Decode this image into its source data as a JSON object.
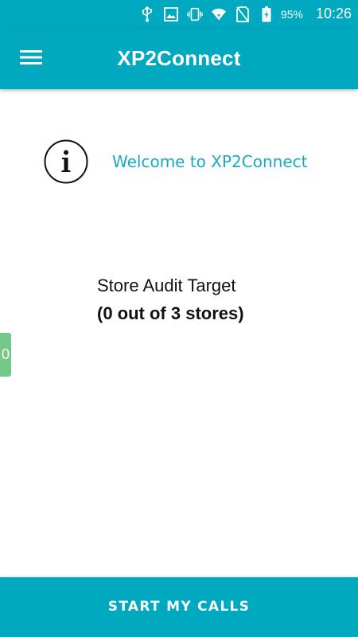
{
  "status_bar": {
    "icons": [
      "usb-icon",
      "image-icon",
      "vibrate-icon",
      "wifi-icon",
      "no-sim-icon",
      "battery-icon"
    ],
    "battery_percent": "95%",
    "time": "10:26"
  },
  "app_bar": {
    "menu_icon": "hamburger-menu-icon",
    "title": "XP2Connect"
  },
  "welcome": {
    "icon": "info-icon",
    "text": "Welcome to XP2Connect"
  },
  "target": {
    "title": "Store Audit Target",
    "count": "(0 out of 3 stores)"
  },
  "side_tab": {
    "label": "0"
  },
  "actions": {
    "start_label": "START MY CALLS"
  },
  "colors": {
    "primary": "#00a9bf",
    "welcome_text": "#1aa9c0",
    "side_tab": "#74c98a"
  }
}
